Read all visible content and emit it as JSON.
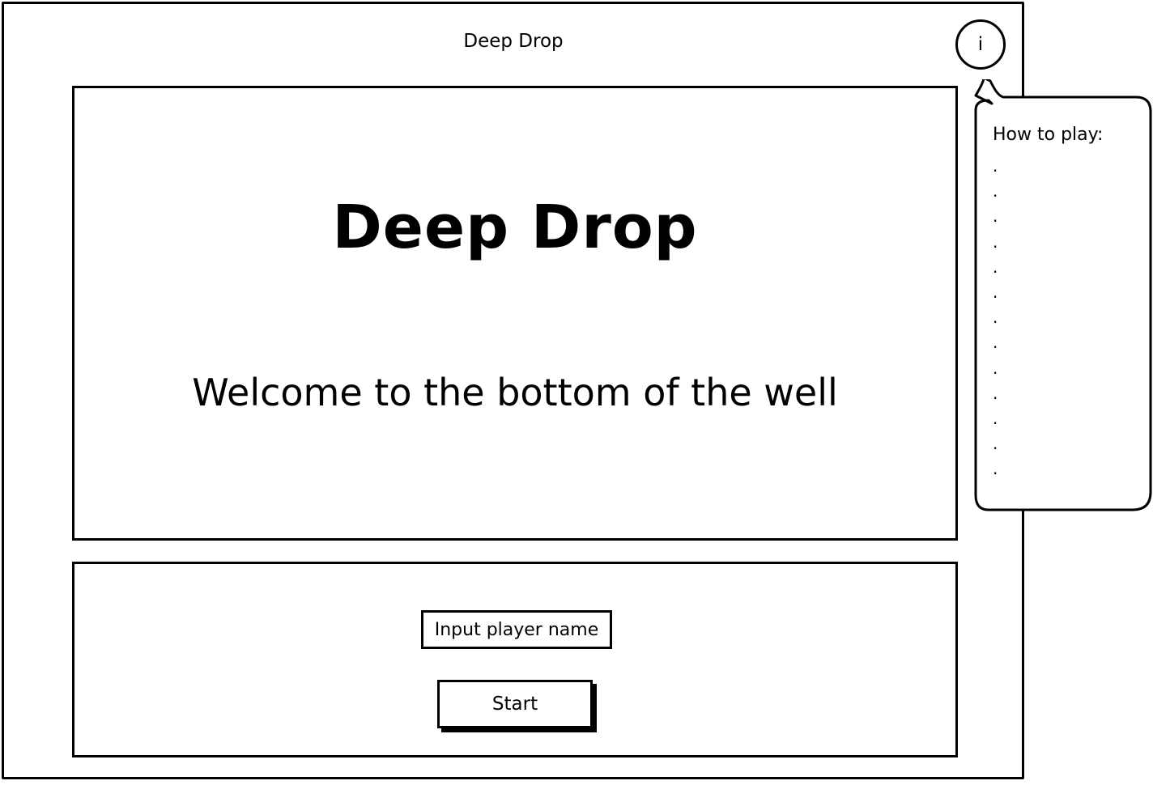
{
  "window": {
    "title": "Deep Drop",
    "info_button_label": "i"
  },
  "hero": {
    "title": "Deep Drop",
    "subtitle": "Welcome to the bottom of the well"
  },
  "controls": {
    "name_input_placeholder": "Input player name",
    "start_label": "Start"
  },
  "help": {
    "title": "How to play:",
    "steps": [
      ".",
      ".",
      ".",
      ".",
      ".",
      ".",
      ".",
      ".",
      ".",
      ".",
      ".",
      ".",
      "."
    ]
  },
  "colors": {
    "ink": "#000000",
    "background": "#ffffff"
  }
}
